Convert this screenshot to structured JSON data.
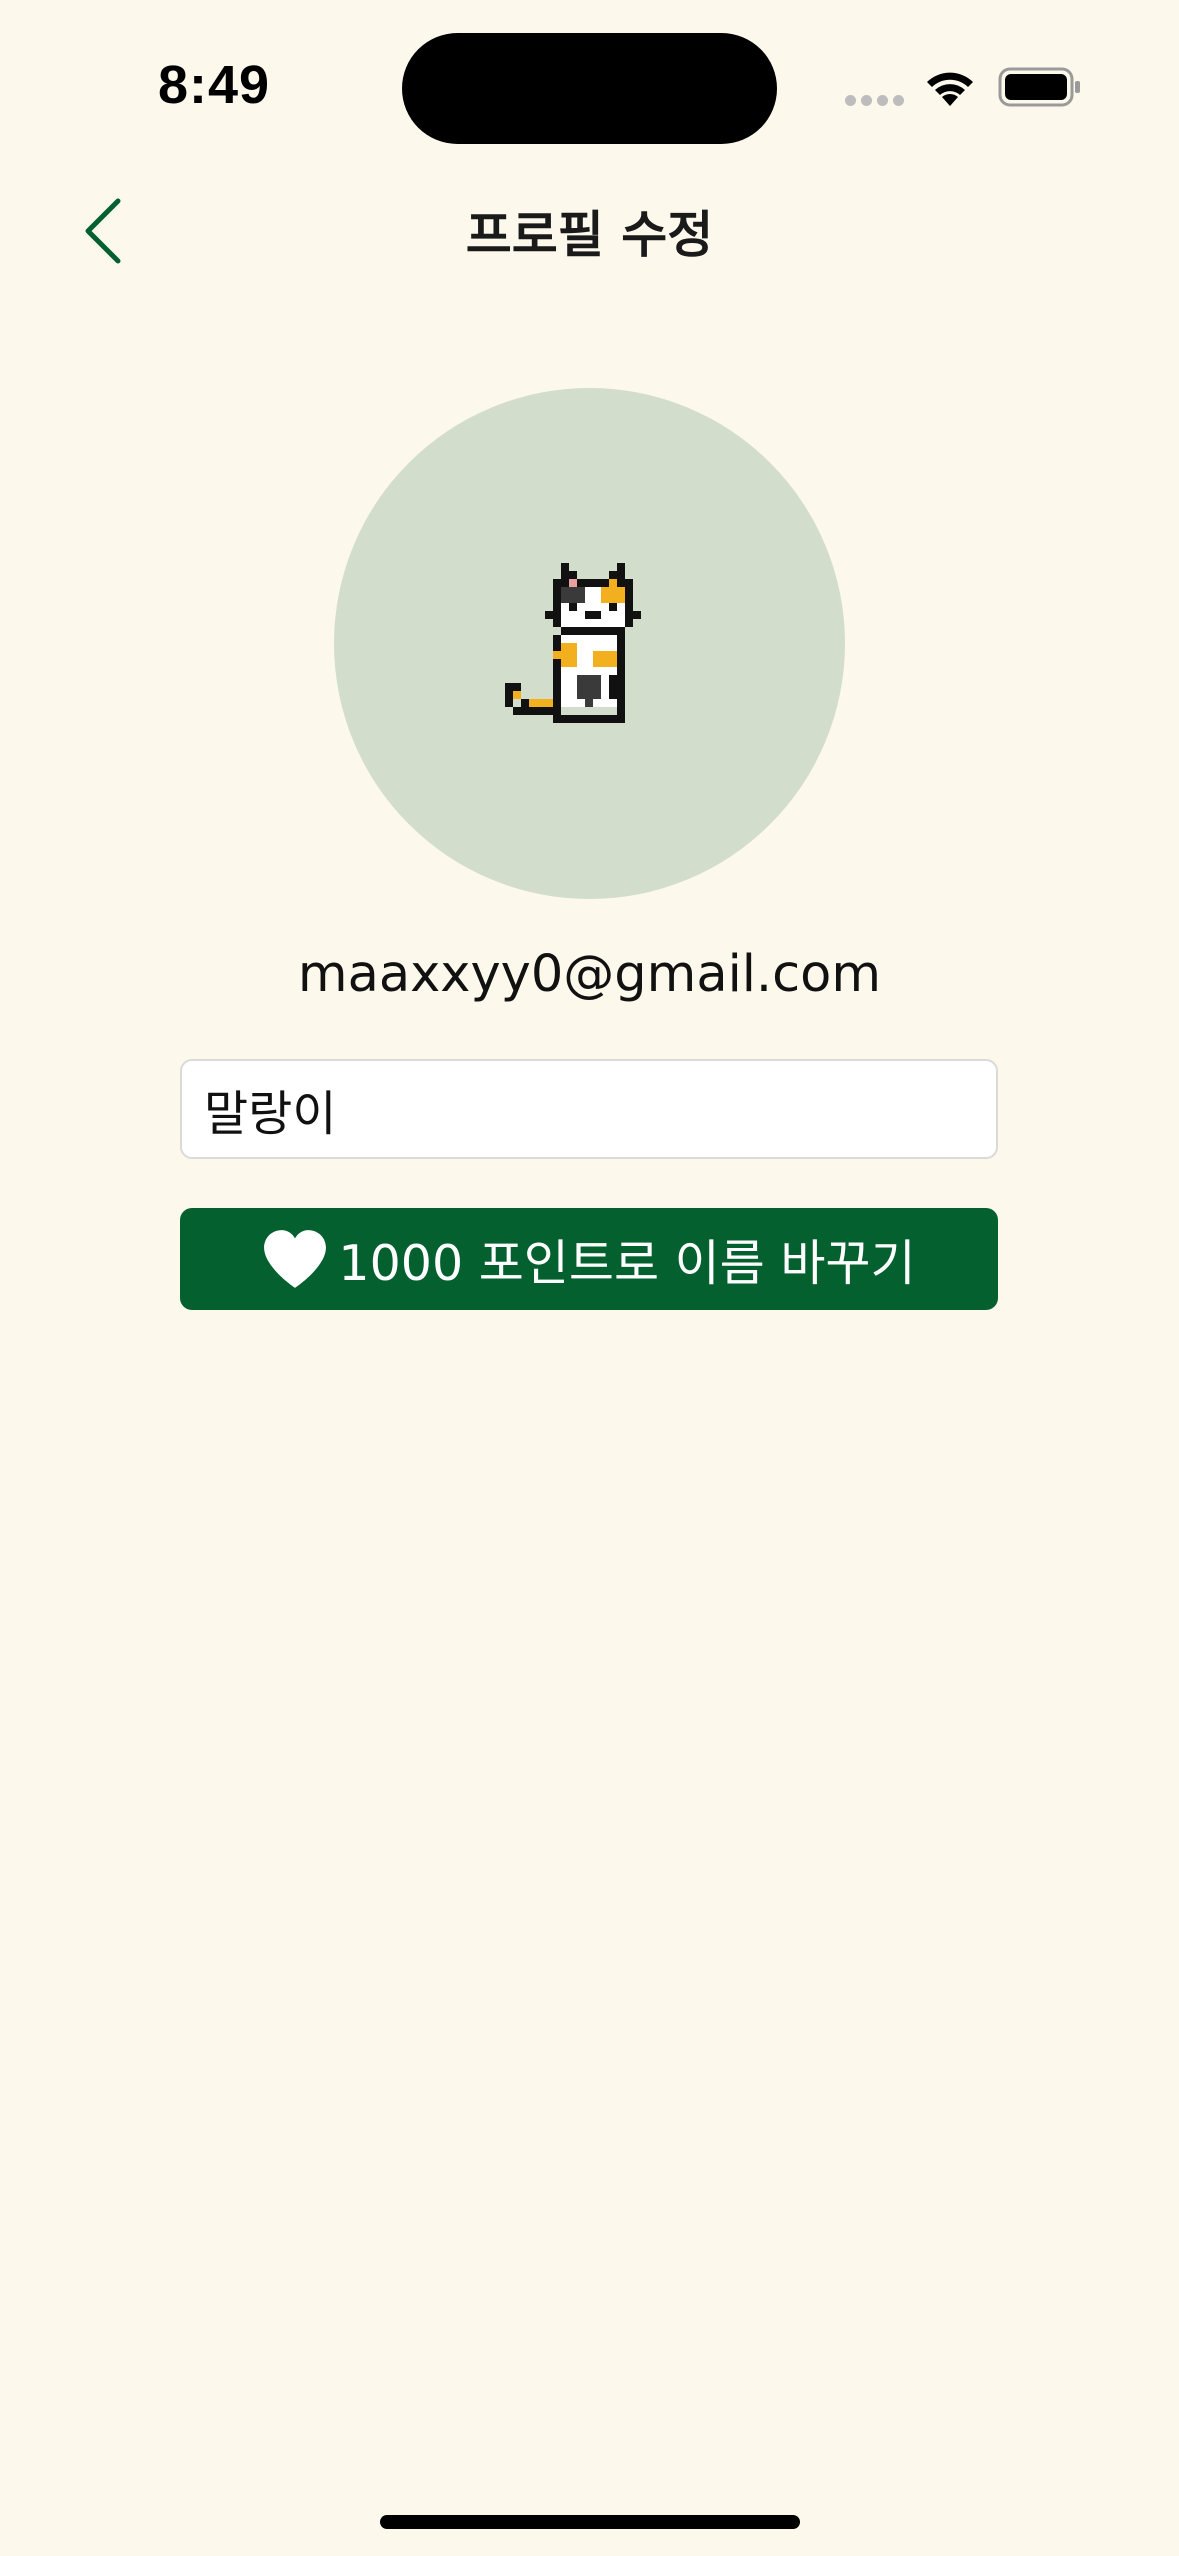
{
  "status_bar": {
    "time": "8:49"
  },
  "header": {
    "title": "프로필 수정",
    "back_icon": "chevron-left-icon"
  },
  "profile": {
    "avatar_icon": "pixel-cat-icon",
    "email": "maaxxyy0@gmail.com"
  },
  "name_field": {
    "value": "말랑이"
  },
  "rename_button": {
    "icon": "heart-icon",
    "label": "1000 포인트로 이름 바꾸기"
  },
  "colors": {
    "background": "#FCF8EC",
    "accent": "#04602F",
    "avatar_bg": "#D3DDCB"
  }
}
